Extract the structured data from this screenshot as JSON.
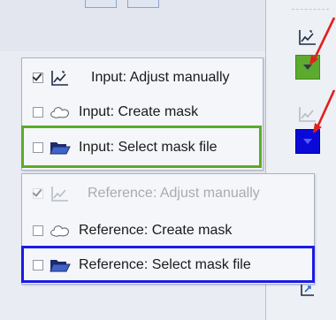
{
  "input_menu": {
    "items": [
      {
        "label": "Input: Adjust manually",
        "checked": true,
        "icon": "chart-edit-icon"
      },
      {
        "label": "Input: Create mask",
        "checked": false,
        "icon": "cloud-outline-icon"
      },
      {
        "label": "Input: Select mask file",
        "checked": false,
        "icon": "open-folder-icon"
      }
    ]
  },
  "reference_menu": {
    "items": [
      {
        "label": "Reference: Adjust manually",
        "checked": true,
        "disabled": true,
        "icon": "chart-edit-icon"
      },
      {
        "label": "Reference: Create mask",
        "checked": false,
        "icon": "cloud-outline-icon"
      },
      {
        "label": "Reference: Select mask file",
        "checked": false,
        "icon": "open-folder-icon"
      }
    ]
  },
  "highlight_colors": {
    "input": "#5aab2a",
    "reference": "#1a1ae6",
    "arrow": "#e02020"
  }
}
